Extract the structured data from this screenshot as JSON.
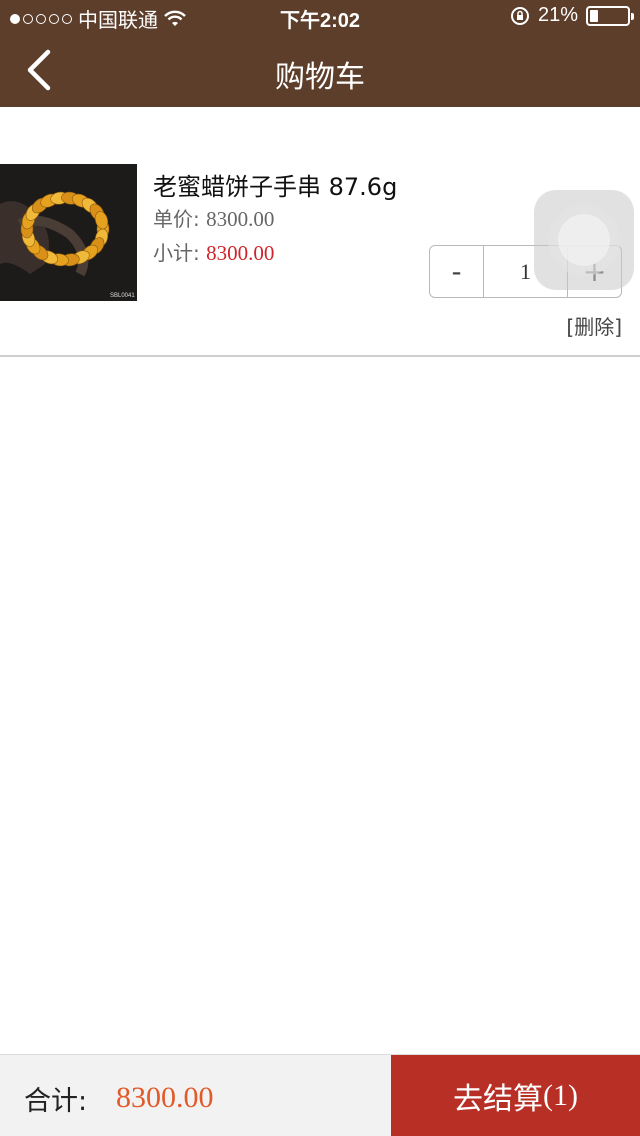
{
  "status_bar": {
    "carrier": "中国联通",
    "time": "下午2:02",
    "battery": "21%",
    "battery_level": 0.21
  },
  "nav": {
    "back_icon": "chevron-left-icon",
    "title": "购物车"
  },
  "cart": {
    "items": [
      {
        "name": "老蜜蜡饼子手串 87.6g",
        "unit_price_label": "单价:",
        "unit_price": "8300.00",
        "subtotal_label": "小计:",
        "subtotal": "8300.00",
        "quantity": "1",
        "decrement_label": "-",
        "increment_label": "+",
        "delete_label": "[删除]",
        "image_watermark": "SBL0041"
      }
    ]
  },
  "footer": {
    "total_label": "合计:",
    "total_value": "8300.00",
    "checkout_label": "去结算",
    "checkout_count": "(1)"
  },
  "colors": {
    "header_bg": "#5c3e2b",
    "checkout_bg": "#b82f25",
    "price_red": "#d0242a",
    "total_orange": "#e05a2a"
  }
}
